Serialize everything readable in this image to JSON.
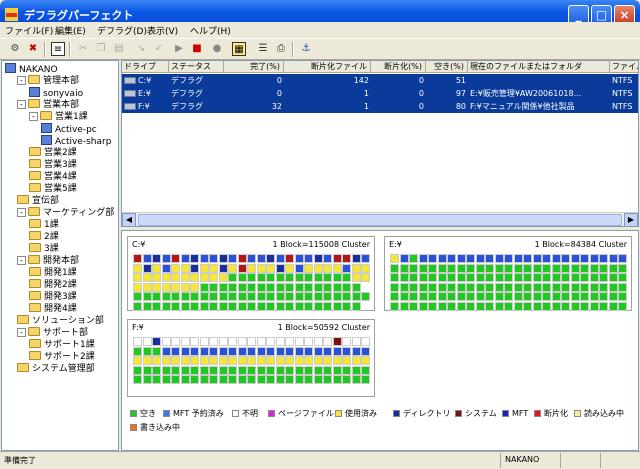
{
  "window": {
    "title": "デフラグパーフェクト"
  },
  "menu": [
    "ファイル(F)",
    "編集(E)",
    "デフラグ(D)",
    "表示(V)",
    "ヘルプ(H)"
  ],
  "tree": [
    {
      "label": "NAKANO",
      "level": 0,
      "icon": "pc",
      "expander": ""
    },
    {
      "label": "管理本部",
      "level": 1,
      "icon": "folder",
      "expander": "-"
    },
    {
      "label": "sonyvaio",
      "level": 2,
      "icon": "pc",
      "expander": ""
    },
    {
      "label": "営業本部",
      "level": 1,
      "icon": "folder",
      "expander": "-"
    },
    {
      "label": "営業1課",
      "level": 2,
      "icon": "folder",
      "expander": "-"
    },
    {
      "label": "Active-pc",
      "level": 3,
      "icon": "pc",
      "expander": ""
    },
    {
      "label": "Active-sharp",
      "level": 3,
      "icon": "pc",
      "expander": ""
    },
    {
      "label": "営業2課",
      "level": 2,
      "icon": "folder",
      "expander": ""
    },
    {
      "label": "営業3課",
      "level": 2,
      "icon": "folder",
      "expander": ""
    },
    {
      "label": "営業4課",
      "level": 2,
      "icon": "folder",
      "expander": ""
    },
    {
      "label": "営業5課",
      "level": 2,
      "icon": "folder",
      "expander": ""
    },
    {
      "label": "宣伝部",
      "level": 1,
      "icon": "folder",
      "expander": ""
    },
    {
      "label": "マーケティング部",
      "level": 1,
      "icon": "folder",
      "expander": "-"
    },
    {
      "label": "1課",
      "level": 2,
      "icon": "folder",
      "expander": ""
    },
    {
      "label": "2課",
      "level": 2,
      "icon": "folder",
      "expander": ""
    },
    {
      "label": "3課",
      "level": 2,
      "icon": "folder",
      "expander": ""
    },
    {
      "label": "開発本部",
      "level": 1,
      "icon": "folder",
      "expander": "-"
    },
    {
      "label": "開発1課",
      "level": 2,
      "icon": "folder",
      "expander": ""
    },
    {
      "label": "開発2課",
      "level": 2,
      "icon": "folder",
      "expander": ""
    },
    {
      "label": "開発3課",
      "level": 2,
      "icon": "folder",
      "expander": ""
    },
    {
      "label": "開発4課",
      "level": 2,
      "icon": "folder",
      "expander": ""
    },
    {
      "label": "ソリューション部",
      "level": 1,
      "icon": "folder",
      "expander": ""
    },
    {
      "label": "サポート部",
      "level": 1,
      "icon": "folder",
      "expander": "-"
    },
    {
      "label": "サポート1課",
      "level": 2,
      "icon": "folder",
      "expander": ""
    },
    {
      "label": "サポート2課",
      "level": 2,
      "icon": "folder",
      "expander": ""
    },
    {
      "label": "システム管理部",
      "level": 1,
      "icon": "folder",
      "expander": ""
    }
  ],
  "list": {
    "columns": [
      "ドライブ",
      "ステータス",
      "完了(%)",
      "断片化ファイル",
      "断片化(%)",
      "空き(%)",
      "現在のファイルまたはフォルダ",
      "ファイル"
    ],
    "rows": [
      {
        "drive": "C:¥",
        "status": "デフラグ",
        "done": "0",
        "frag_files": "142",
        "frag_pct": "0",
        "free": "51",
        "current": "",
        "fs": "NTFS"
      },
      {
        "drive": "E:¥",
        "status": "デフラグ",
        "done": "0",
        "frag_files": "1",
        "frag_pct": "0",
        "free": "97",
        "current": "E:¥販売管理¥AW20061018...",
        "fs": "NTFS"
      },
      {
        "drive": "F:¥",
        "status": "デフラグ",
        "done": "32",
        "frag_files": "1",
        "frag_pct": "0",
        "free": "80",
        "current": "F:¥マニュアル関係¥他社製品",
        "fs": "NTFS"
      }
    ]
  },
  "panels": [
    {
      "drive": "C:¥",
      "info": "1 Block=115008 Cluster"
    },
    {
      "drive": "E:¥",
      "info": "1 Block=84384 Cluster"
    },
    {
      "drive": "F:¥",
      "info": "1 Block=50592 Cluster"
    }
  ],
  "legend": [
    {
      "label": "空き",
      "color": "#22c822"
    },
    {
      "label": "MFT 予約済み",
      "color": "#3a78f0"
    },
    {
      "label": "不明",
      "color": "#ffffff"
    },
    {
      "label": "ページファイル",
      "color": "#e020e0"
    },
    {
      "label": "使用済み",
      "color": "#f5e63a"
    },
    {
      "label": "ディレクトリ",
      "color": "#1a2f9a"
    },
    {
      "label": "システム",
      "color": "#7a1010"
    },
    {
      "label": "MFT",
      "color": "#2020c0"
    },
    {
      "label": "断片化",
      "color": "#e01818"
    },
    {
      "label": "読み込み中",
      "color": "#f5f0a0"
    },
    {
      "label": "書き込み中",
      "color": "#f07020"
    }
  ],
  "status": {
    "left": "準備完了",
    "machine": "NAKANO"
  }
}
